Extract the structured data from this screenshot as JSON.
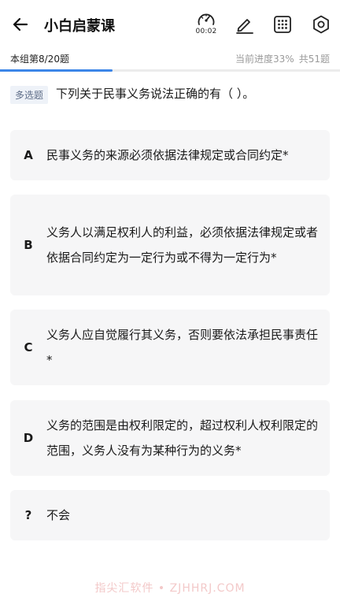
{
  "header": {
    "title": "小白启蒙课",
    "timer": "00:02",
    "icons": {
      "back": "arrow-left-icon",
      "timer": "stopwatch-icon",
      "edit": "pencil-icon",
      "grid": "grid-icon",
      "settings": "hexagon-settings-icon"
    }
  },
  "progress": {
    "group_label": "本组第8/20题",
    "current": "当前进度33%",
    "total": "共51题",
    "fraction": 0.33
  },
  "question": {
    "type": "多选题",
    "text": "下列关于民事义务说法正确的有（ ）。"
  },
  "options": [
    {
      "letter": "A",
      "text": "民事义务的来源必须依据法律规定或合同约定*"
    },
    {
      "letter": "B",
      "text": "义务人以满足权利人的利益，必须依据法律规定或者依据合同约定为一定行为或不得为一定行为*"
    },
    {
      "letter": "C",
      "text": "义务人应自觉履行其义务，否则要依法承担民事责任*"
    },
    {
      "letter": "D",
      "text": "义务的范围是由权利限定的，超过权利人权利限定的范围，义务人没有为某种行为的义务*"
    },
    {
      "letter": "?",
      "text": "不会"
    }
  ],
  "watermark": "指尖汇软件 • ZJHHRJ.COM",
  "colors": {
    "accent": "#3c86e8",
    "option_bg": "#f6f6f7",
    "tag_bg": "#eef2f8"
  }
}
